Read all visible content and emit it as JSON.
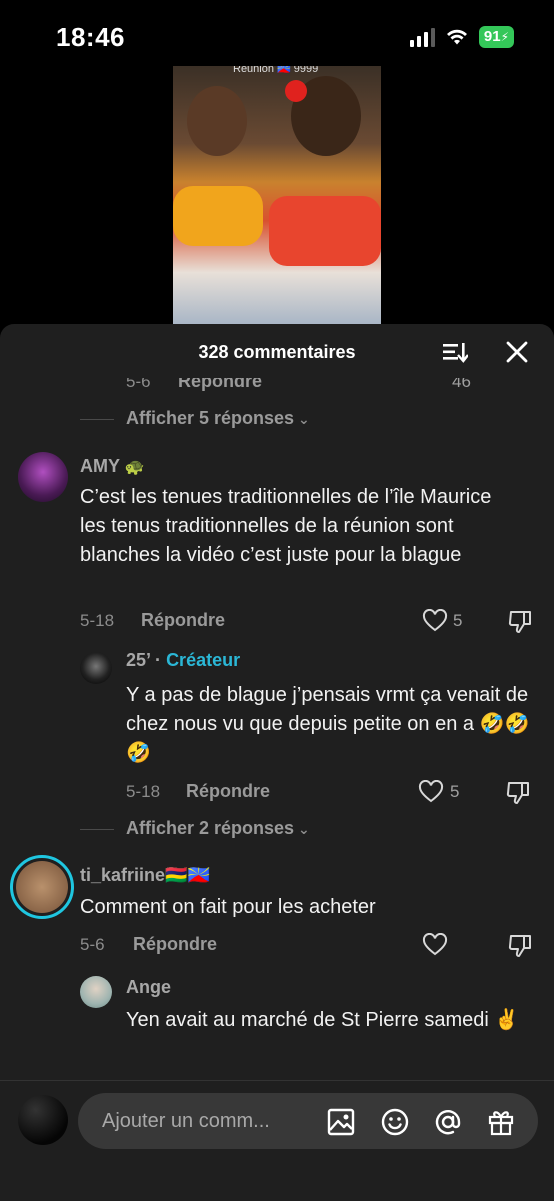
{
  "status_bar": {
    "time": "18:46",
    "battery": "91"
  },
  "video": {
    "caption": "Réunion 🇷🇪 9999"
  },
  "sheet": {
    "title": "328 commentaires"
  },
  "partial_row": {
    "date": "5-6",
    "reply": "Répondre",
    "likes": "46"
  },
  "thread1": {
    "show_replies": "Afficher 5 réponses"
  },
  "comment_amy": {
    "username": "AMY",
    "text": "C’est les tenues traditionnelles de l’île Maurice les tenus traditionnelles de la réunion sont blanches la vidéo c’est juste pour la blague",
    "date": "5-18",
    "reply": "Répondre",
    "likes": "5"
  },
  "reply_creator": {
    "username": "25’",
    "separator": "·",
    "badge": "Créateur",
    "text": "Y a pas de blague j’pensais vrmt ça venait de chez nous vu que depuis petite on en a 🤣🤣🤣",
    "date": "5-18",
    "reply": "Répondre",
    "likes": "5"
  },
  "thread2": {
    "show_replies": "Afficher 2 réponses"
  },
  "comment_kafriine": {
    "username": "ti_kafriine🇲🇺🇷🇪",
    "text": "Comment on fait pour les acheter",
    "date": "5-6",
    "reply": "Répondre"
  },
  "reply_ange": {
    "username": "Ange",
    "text": "Yen avait au marché de St Pierre samedi ✌️"
  },
  "input": {
    "placeholder": "Ajouter un comm..."
  },
  "colors": {
    "creator_badge": "#2bb7d6",
    "battery": "#34c759",
    "sheet_bg": "#1f1f1f"
  }
}
